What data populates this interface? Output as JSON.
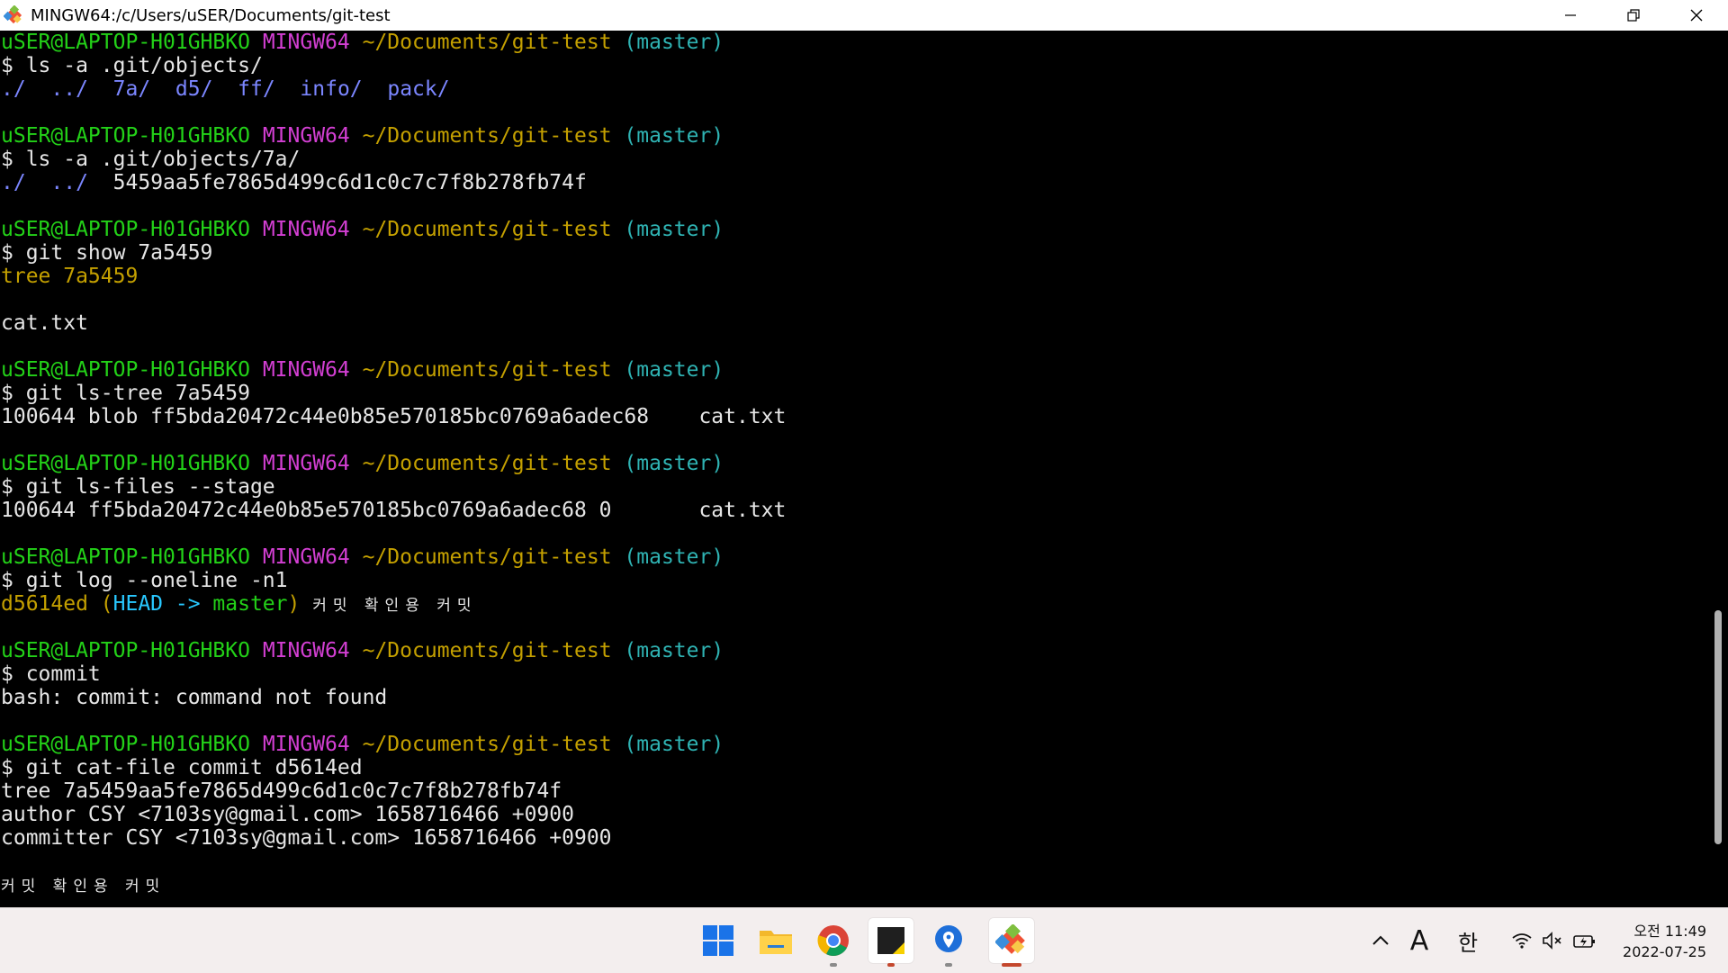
{
  "window": {
    "title": "MINGW64:/c/Users/uSER/Documents/git-test"
  },
  "colors": {
    "user": "#23d118",
    "shell": "#d33fd3",
    "path": "#c4a000",
    "branch": "#2fb3b3",
    "dir": "#7b86ff",
    "text": "#e6e6e6",
    "yellow": "#c4a000",
    "head": "#28c8ff",
    "master": "#23d118"
  },
  "terminal": {
    "lines": [
      [
        {
          "t": "uSER@LAPTOP-H01GHBKO",
          "c": "user"
        },
        {
          "t": " "
        },
        {
          "t": "MINGW64",
          "c": "shell"
        },
        {
          "t": " "
        },
        {
          "t": "~/Documents/git-test",
          "c": "path"
        },
        {
          "t": " "
        },
        {
          "t": "(master)",
          "c": "branch"
        }
      ],
      [
        {
          "t": "$ ls -a .git/objects/"
        }
      ],
      [
        {
          "t": "./",
          "c": "dir"
        },
        {
          "t": "  "
        },
        {
          "t": "../",
          "c": "dir"
        },
        {
          "t": "  "
        },
        {
          "t": "7a/",
          "c": "dir"
        },
        {
          "t": "  "
        },
        {
          "t": "d5/",
          "c": "dir"
        },
        {
          "t": "  "
        },
        {
          "t": "ff/",
          "c": "dir"
        },
        {
          "t": "  "
        },
        {
          "t": "info/",
          "c": "dir"
        },
        {
          "t": "  "
        },
        {
          "t": "pack/",
          "c": "dir"
        }
      ],
      [
        {
          "t": ""
        }
      ],
      [
        {
          "t": "uSER@LAPTOP-H01GHBKO",
          "c": "user"
        },
        {
          "t": " "
        },
        {
          "t": "MINGW64",
          "c": "shell"
        },
        {
          "t": " "
        },
        {
          "t": "~/Documents/git-test",
          "c": "path"
        },
        {
          "t": " "
        },
        {
          "t": "(master)",
          "c": "branch"
        }
      ],
      [
        {
          "t": "$ ls -a .git/objects/7a/"
        }
      ],
      [
        {
          "t": "./",
          "c": "dir"
        },
        {
          "t": "  "
        },
        {
          "t": "../",
          "c": "dir"
        },
        {
          "t": "  5459aa5fe7865d499c6d1c0c7c7f8b278fb74f"
        }
      ],
      [
        {
          "t": ""
        }
      ],
      [
        {
          "t": "uSER@LAPTOP-H01GHBKO",
          "c": "user"
        },
        {
          "t": " "
        },
        {
          "t": "MINGW64",
          "c": "shell"
        },
        {
          "t": " "
        },
        {
          "t": "~/Documents/git-test",
          "c": "path"
        },
        {
          "t": " "
        },
        {
          "t": "(master)",
          "c": "branch"
        }
      ],
      [
        {
          "t": "$ git show 7a5459"
        }
      ],
      [
        {
          "t": "tree 7a5459",
          "c": "yellow"
        }
      ],
      [
        {
          "t": ""
        }
      ],
      [
        {
          "t": "cat.txt"
        }
      ],
      [
        {
          "t": ""
        }
      ],
      [
        {
          "t": "uSER@LAPTOP-H01GHBKO",
          "c": "user"
        },
        {
          "t": " "
        },
        {
          "t": "MINGW64",
          "c": "shell"
        },
        {
          "t": " "
        },
        {
          "t": "~/Documents/git-test",
          "c": "path"
        },
        {
          "t": " "
        },
        {
          "t": "(master)",
          "c": "branch"
        }
      ],
      [
        {
          "t": "$ git ls-tree 7a5459"
        }
      ],
      [
        {
          "t": "100644 blob ff5bda20472c44e0b85e570185bc0769a6adec68    cat.txt"
        }
      ],
      [
        {
          "t": ""
        }
      ],
      [
        {
          "t": "uSER@LAPTOP-H01GHBKO",
          "c": "user"
        },
        {
          "t": " "
        },
        {
          "t": "MINGW64",
          "c": "shell"
        },
        {
          "t": " "
        },
        {
          "t": "~/Documents/git-test",
          "c": "path"
        },
        {
          "t": " "
        },
        {
          "t": "(master)",
          "c": "branch"
        }
      ],
      [
        {
          "t": "$ git ls-files --stage"
        }
      ],
      [
        {
          "t": "100644 ff5bda20472c44e0b85e570185bc0769a6adec68 0       cat.txt"
        }
      ],
      [
        {
          "t": ""
        }
      ],
      [
        {
          "t": "uSER@LAPTOP-H01GHBKO",
          "c": "user"
        },
        {
          "t": " "
        },
        {
          "t": "MINGW64",
          "c": "shell"
        },
        {
          "t": " "
        },
        {
          "t": "~/Documents/git-test",
          "c": "path"
        },
        {
          "t": " "
        },
        {
          "t": "(master)",
          "c": "branch"
        }
      ],
      [
        {
          "t": "$ git log --oneline -n1"
        }
      ],
      [
        {
          "t": "d5614ed",
          "c": "yellow"
        },
        {
          "t": " (",
          "c": "yellow"
        },
        {
          "t": "HEAD -> ",
          "c": "head"
        },
        {
          "t": "master",
          "c": "master"
        },
        {
          "t": ")",
          "c": "yellow"
        },
        {
          "t": " "
        },
        {
          "t": "커밋 확인용 커밋",
          "ko": true
        }
      ],
      [
        {
          "t": ""
        }
      ],
      [
        {
          "t": "uSER@LAPTOP-H01GHBKO",
          "c": "user"
        },
        {
          "t": " "
        },
        {
          "t": "MINGW64",
          "c": "shell"
        },
        {
          "t": " "
        },
        {
          "t": "~/Documents/git-test",
          "c": "path"
        },
        {
          "t": " "
        },
        {
          "t": "(master)",
          "c": "branch"
        }
      ],
      [
        {
          "t": "$ commit"
        }
      ],
      [
        {
          "t": "bash: commit: command not found"
        }
      ],
      [
        {
          "t": ""
        }
      ],
      [
        {
          "t": "uSER@LAPTOP-H01GHBKO",
          "c": "user"
        },
        {
          "t": " "
        },
        {
          "t": "MINGW64",
          "c": "shell"
        },
        {
          "t": " "
        },
        {
          "t": "~/Documents/git-test",
          "c": "path"
        },
        {
          "t": " "
        },
        {
          "t": "(master)",
          "c": "branch"
        }
      ],
      [
        {
          "t": "$ git cat-file commit d5614ed"
        }
      ],
      [
        {
          "t": "tree 7a5459aa5fe7865d499c6d1c0c7c7f8b278fb74f"
        }
      ],
      [
        {
          "t": "author CSY <7103sy@gmail.com> 1658716466 +0900"
        }
      ],
      [
        {
          "t": "committer CSY <7103sy@gmail.com> 1658716466 +0900"
        }
      ],
      [
        {
          "t": ""
        }
      ],
      [
        {
          "t": "커밋 확인용 커밋",
          "ko": true
        }
      ]
    ]
  },
  "taskbar": {
    "apps": [
      {
        "name": "windows-start-icon"
      },
      {
        "name": "file-explorer-icon"
      },
      {
        "name": "chrome-icon"
      },
      {
        "name": "sticky-notes-icon"
      },
      {
        "name": "maps-pin-icon"
      },
      {
        "name": "git-bash-icon"
      }
    ],
    "tray": {
      "chevron": "^",
      "ime_mode": "A",
      "ime_lang": "한"
    },
    "clock": {
      "time": "오전 11:49",
      "date": "2022-07-25"
    }
  }
}
